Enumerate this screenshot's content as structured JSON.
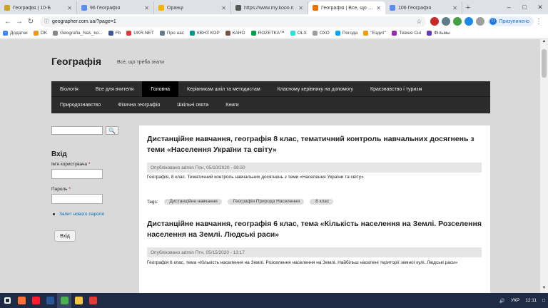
{
  "browser": {
    "tabs": [
      {
        "label": "Географія | 10-Б",
        "color": "#c9a227",
        "active": false
      },
      {
        "label": "96 Географія",
        "color": "#5b8def",
        "active": false
      },
      {
        "label": "Оранці",
        "color": "#f4b400",
        "active": false
      },
      {
        "label": "https://www.my.kooo.n",
        "color": "#555555",
        "active": false
      },
      {
        "label": "Географія | Все, що треба",
        "color": "#e8710a",
        "active": true
      },
      {
        "label": "106 Географія",
        "color": "#5b8def",
        "active": false
      }
    ],
    "new_tab": "+",
    "url": "geographer.com.ua/?page=1",
    "profile_label": "Призупинено",
    "profile_initial": "П"
  },
  "bookmarks": [
    {
      "label": "Додатки",
      "color": "#4285f4"
    },
    {
      "label": "OK",
      "color": "#f7931e"
    },
    {
      "label": "Geografia_Nas_ko...",
      "color": "#888888"
    },
    {
      "label": "Fb",
      "color": "#3b5998"
    },
    {
      "label": "UKR.NET",
      "color": "#e53935"
    },
    {
      "label": "Про нас",
      "color": "#607d8b"
    },
    {
      "label": "КВНЗ КОР",
      "color": "#009688"
    },
    {
      "label": "КАНО",
      "color": "#795548"
    },
    {
      "label": "ROZETKA™",
      "color": "#00a046"
    },
    {
      "label": "OLX",
      "color": "#23e5db"
    },
    {
      "label": "ОХО",
      "color": "#9e9e9e"
    },
    {
      "label": "Погода",
      "color": "#03a9f4"
    },
    {
      "label": "\"Ездит\"",
      "color": "#ff9800"
    },
    {
      "label": "Тевіня Сні",
      "color": "#9c27b0"
    },
    {
      "label": "Фільмы",
      "color": "#673ab7"
    }
  ],
  "site": {
    "name": "Географія",
    "slogan": "Все, що треба знати"
  },
  "menu": {
    "row1": [
      {
        "label": "Біологія",
        "active": false
      },
      {
        "label": "Все для вчителя",
        "active": false
      },
      {
        "label": "Головна",
        "active": true
      },
      {
        "label": "Керівникам шкіл та методистам",
        "active": false
      },
      {
        "label": "Класному керівнику на допомогу",
        "active": false
      },
      {
        "label": "Краєзнавство і туризм",
        "active": false
      }
    ],
    "row2": [
      {
        "label": "Природознавство",
        "active": false
      },
      {
        "label": "Фізична географія",
        "active": false
      },
      {
        "label": "Шкільні свята",
        "active": false
      },
      {
        "label": "Книги",
        "active": false
      }
    ]
  },
  "sidebar": {
    "search_button": "🔍",
    "login_title": "Вхід",
    "username_label": "Ім'я користувача",
    "password_label": "Пароль",
    "required_mark": "*",
    "forgot_link": "Запит нового пароля",
    "login_button": "Вхід"
  },
  "articles": [
    {
      "title": "Дистанційне навчання, географія 8 клас, тематичний контроль навчальних досягнень з теми «Населення України та світу»",
      "meta": "Опубліковано admin Пон, 05/10/2020 - 08:50",
      "body": "Географія, 8 клас. Тематичний контроль навчальних досягнень з теми «Населення України та світу»",
      "tags_label": "Tags:",
      "tags": [
        "Дистанційне навчання",
        "Географія Природа Населення",
        "8 клас"
      ]
    },
    {
      "title": "Дистанційне навчання, географія 6 клас, тема «Кількість населення на Землі. Розселення населення на Землі. Людські раси»",
      "meta": "Опубліковано admin Птн, 05/15/2020 - 13:17",
      "body": "Географія 6 клас, тема «Кількість населення на Землі. Розселення населення на Землі. Найбільш населені території земної кулі. Людські раси»"
    }
  ],
  "taskbar": {
    "apps": [
      {
        "name": "windows-start",
        "color": "#ffffff"
      },
      {
        "name": "firefox",
        "color": "#ff7139"
      },
      {
        "name": "opera",
        "color": "#ff1b2d"
      },
      {
        "name": "word",
        "color": "#2b579a"
      },
      {
        "name": "chrome",
        "color": "#4caf50"
      },
      {
        "name": "explorer",
        "color": "#f4c542"
      },
      {
        "name": "photos",
        "color": "#e53935"
      }
    ],
    "lang": "УКР",
    "time": "12:11"
  }
}
